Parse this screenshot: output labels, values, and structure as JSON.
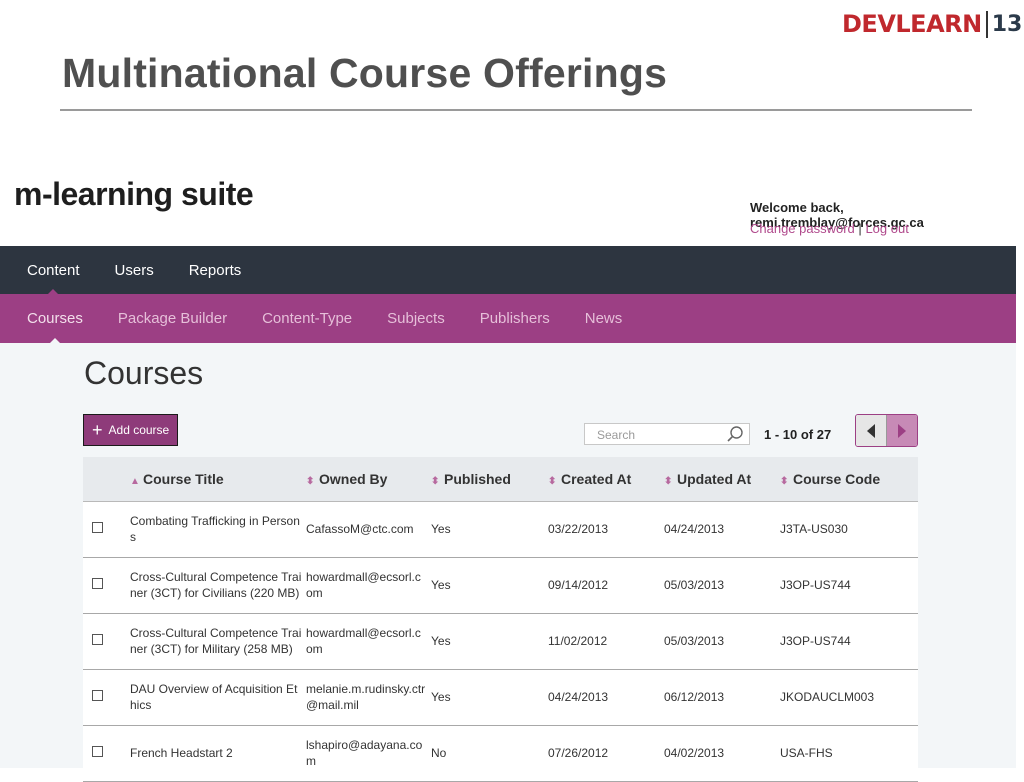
{
  "slide": {
    "title": "Multinational Course Offerings",
    "logo_word": "DevLearn",
    "logo_number": "13"
  },
  "app": {
    "brand": "m-learning suite",
    "welcome": "Welcome back, remi.tremblay@forces.gc.ca",
    "change_password": "Change password",
    "separator": "|",
    "logout": "Log out",
    "nav_primary": [
      {
        "label": "Content",
        "active": true
      },
      {
        "label": "Users",
        "active": false
      },
      {
        "label": "Reports",
        "active": false
      }
    ],
    "nav_secondary": [
      {
        "label": "Courses",
        "active": true
      },
      {
        "label": "Package Builder",
        "active": false
      },
      {
        "label": "Content-Type",
        "active": false
      },
      {
        "label": "Subjects",
        "active": false
      },
      {
        "label": "Publishers",
        "active": false
      },
      {
        "label": "News",
        "active": false
      }
    ],
    "page_heading": "Courses",
    "add_button": "Add course",
    "search_placeholder": "Search",
    "pagination": "1 - 10 of 27",
    "colors": {
      "nav_dark": "#2d3540",
      "accent": "#9c3f84"
    },
    "columns": [
      {
        "label": "Course Title",
        "sort": "asc"
      },
      {
        "label": "Owned By",
        "sort": "none"
      },
      {
        "label": "Published",
        "sort": "none"
      },
      {
        "label": "Created At",
        "sort": "none"
      },
      {
        "label": "Updated At",
        "sort": "none"
      },
      {
        "label": "Course Code",
        "sort": "none"
      }
    ],
    "rows": [
      {
        "title": "Combating Trafficking in Persons",
        "owner": "CafassoM@ctc.com",
        "published": "Yes",
        "created": "03/22/2013",
        "updated": "04/24/2013",
        "code": "J3TA-US030"
      },
      {
        "title": "Cross-Cultural Competence Trainer (3CT) for Civilians (220 MB)",
        "owner": "howardmall@ecsorl.com",
        "published": "Yes",
        "created": "09/14/2012",
        "updated": "05/03/2013",
        "code": "J3OP-US744"
      },
      {
        "title": "Cross-Cultural Competence Trainer (3CT) for Military (258 MB)",
        "owner": "howardmall@ecsorl.com",
        "published": "Yes",
        "created": "11/02/2012",
        "updated": "05/03/2013",
        "code": "J3OP-US744"
      },
      {
        "title": "DAU Overview of Acquisition Ethics",
        "owner": "melanie.m.rudinsky.ctr@mail.mil",
        "published": "Yes",
        "created": "04/24/2013",
        "updated": "06/12/2013",
        "code": "JKODAUCLM003"
      },
      {
        "title": "French Headstart 2",
        "owner": "lshapiro@adayana.com",
        "published": "No",
        "created": "07/26/2012",
        "updated": "04/02/2013",
        "code": "USA-FHS"
      }
    ]
  }
}
